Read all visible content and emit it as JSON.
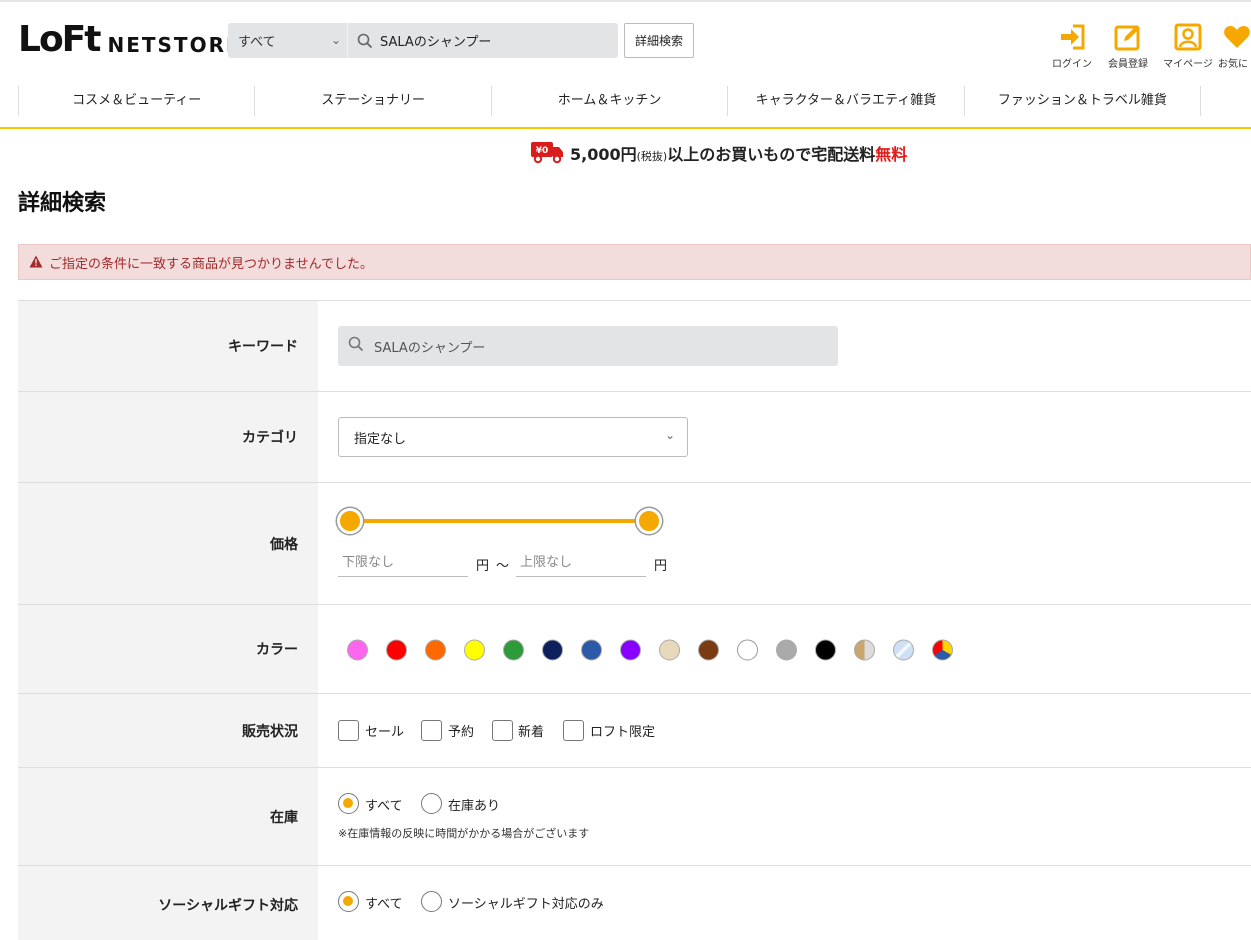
{
  "header": {
    "logo_mark": "LoFt",
    "logo_text": "NETSTORE",
    "search_scope": "すべて",
    "search_value": "SALAのシャンプー",
    "advanced_search": "詳細検索",
    "icons": [
      {
        "name": "login-icon",
        "label": "ログイン"
      },
      {
        "name": "register-icon",
        "label": "会員登録"
      },
      {
        "name": "mypage-icon",
        "label": "マイページ"
      },
      {
        "name": "favorites-icon",
        "label": "お気に"
      }
    ]
  },
  "nav": {
    "items": [
      "コスメ＆ビューティー",
      "ステーショナリー",
      "ホーム＆キッチン",
      "キャラクター＆バラエティ雑貨",
      "ファッション＆トラベル雑貨"
    ]
  },
  "shipping": {
    "badge": "¥0",
    "amount": "5,000円",
    "tax": "(税抜)",
    "middle": "以上のお買いもので宅配送料",
    "free": "無料"
  },
  "page": {
    "title": "詳細検索",
    "alert": "ご指定の条件に一致する商品が見つかりませんでした。"
  },
  "form": {
    "keyword": {
      "label": "キーワード",
      "placeholder": "SALAのシャンプー"
    },
    "category": {
      "label": "カテゴリ",
      "value": "指定なし"
    },
    "price": {
      "label": "価格",
      "min_placeholder": "下限なし",
      "max_placeholder": "上限なし",
      "unit": "円",
      "separator": "～",
      "slider_min": 0,
      "slider_max": 1
    },
    "color": {
      "label": "カラー",
      "swatches": [
        {
          "name": "pink",
          "color": "#ff66ee"
        },
        {
          "name": "red",
          "color": "#ff0000"
        },
        {
          "name": "orange",
          "color": "#ff6a00"
        },
        {
          "name": "yellow",
          "color": "#ffff00"
        },
        {
          "name": "green",
          "color": "#2e9b3a"
        },
        {
          "name": "navy",
          "color": "#0d1f5c"
        },
        {
          "name": "blue",
          "color": "#2d5aa8"
        },
        {
          "name": "purple",
          "color": "#8800ff"
        },
        {
          "name": "beige",
          "color": "#e8d9bd"
        },
        {
          "name": "brown",
          "color": "#7a3b12"
        },
        {
          "name": "white",
          "color": "#ffffff"
        },
        {
          "name": "gray",
          "color": "#aaaaaa"
        },
        {
          "name": "black",
          "color": "#000000"
        },
        {
          "name": "gold",
          "color": "#c9a66b"
        },
        {
          "name": "silver",
          "color": "#cfe0f5"
        },
        {
          "name": "multi",
          "color": "#ffd400"
        }
      ]
    },
    "sale_status": {
      "label": "販売状況",
      "options": [
        "セール",
        "予約",
        "新着",
        "ロフト限定"
      ]
    },
    "stock": {
      "label": "在庫",
      "options": [
        "すべて",
        "在庫あり"
      ],
      "selected": "すべて",
      "note": "※在庫情報の反映に時間がかかる場合がございます"
    },
    "gift": {
      "label": "ソーシャルギフト対応",
      "options": [
        "すべて",
        "ソーシャルギフト対応のみ"
      ],
      "selected": "すべて"
    }
  },
  "colors": {
    "accent": "#f5a800",
    "nav_underline": "#f6c700",
    "alert_bg": "#f3dcdc",
    "alert_text": "#a12b2b"
  }
}
